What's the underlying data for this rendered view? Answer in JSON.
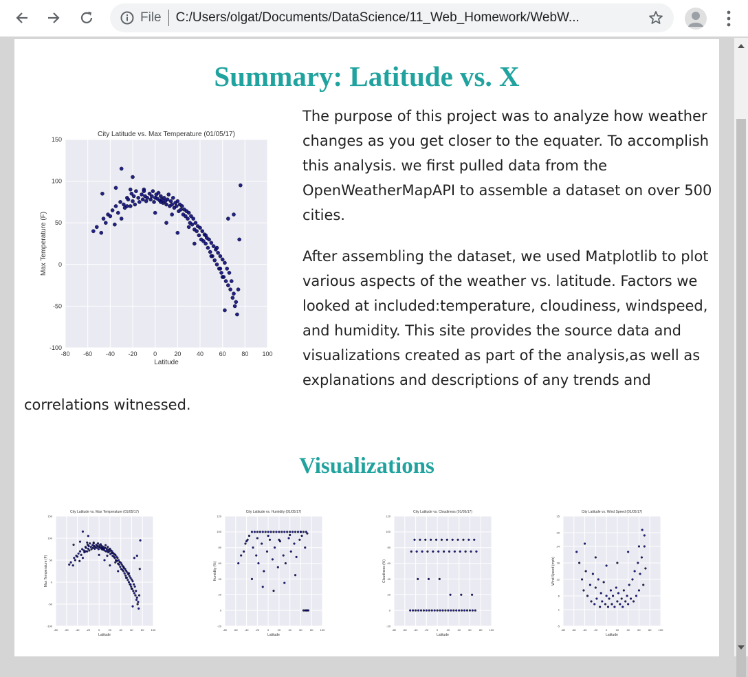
{
  "browser": {
    "scheme": "File",
    "url": "C:/Users/olgat/Documents/DataScience/11_Web_Homework/WebW..."
  },
  "page": {
    "title": "Summary: Latitude vs. X",
    "paragraph1": "The purpose of this project was to analyze how weather changes as you get closer to the equater. To accomplish this analysis. we first pulled data from the OpenWeatherMapAPI to assemble a dataset on over 500 cities.",
    "paragraph2": "After assembling the dataset, we used Matplotlib to plot various aspects of the weather vs. latitude. Factors we looked at included:temperature, cloudiness, windspeed, and humidity. This site provides the source data and visualizations created as part of the analysis,as well as explanations and descriptions of any trends and correlations witnessed.",
    "visualizations_title": "Visualizations"
  },
  "colors": {
    "accent": "#20a39e",
    "plot_bg": "#eaeaf2",
    "point": "#0b0b7a"
  },
  "chart_data": [
    {
      "type": "scatter",
      "title": "City Latitude vs. Max Temperature (01/05/17)",
      "xlabel": "Latitude",
      "ylabel": "Max Temperature (F)",
      "xlim": [
        -80,
        100
      ],
      "ylim": [
        -100,
        150
      ],
      "xticks": [
        -80,
        -60,
        -40,
        -20,
        0,
        20,
        40,
        60,
        80,
        100
      ],
      "yticks": [
        -100,
        -50,
        0,
        50,
        100,
        150
      ],
      "grid": true,
      "x": [
        -55,
        -52,
        -48,
        -46,
        -44,
        -42,
        -40,
        -38,
        -36,
        -35,
        -33,
        -31,
        -30,
        -28,
        -27,
        -25,
        -24,
        -22,
        -21,
        -20,
        -19,
        -18,
        -17,
        -15,
        -14,
        -12,
        -11,
        -10,
        -9,
        -8,
        -7,
        -5,
        -4,
        -3,
        -2,
        -1,
        0,
        1,
        2,
        3,
        4,
        5,
        6,
        7,
        8,
        9,
        10,
        11,
        12,
        13,
        14,
        15,
        16,
        17,
        18,
        19,
        20,
        21,
        22,
        23,
        24,
        25,
        26,
        27,
        28,
        29,
        30,
        31,
        32,
        33,
        34,
        35,
        36,
        37,
        38,
        39,
        40,
        41,
        42,
        43,
        44,
        45,
        46,
        47,
        48,
        49,
        50,
        51,
        52,
        53,
        54,
        55,
        56,
        57,
        58,
        59,
        60,
        61,
        62,
        63,
        64,
        65,
        66,
        67,
        68,
        69,
        70,
        71,
        72,
        73,
        74,
        75,
        76,
        -30,
        -20,
        -22,
        -10,
        5,
        15,
        30,
        45,
        55,
        60,
        65,
        70,
        -47,
        -35,
        -25,
        0,
        10,
        20,
        35,
        50,
        58,
        62,
        68,
        72
      ],
      "y": [
        40,
        45,
        38,
        55,
        50,
        60,
        58,
        65,
        48,
        70,
        62,
        75,
        55,
        72,
        68,
        80,
        78,
        70,
        85,
        76,
        82,
        72,
        88,
        80,
        75,
        84,
        78,
        90,
        82,
        76,
        80,
        85,
        78,
        82,
        88,
        75,
        80,
        84,
        79,
        86,
        77,
        82,
        78,
        74,
        80,
        76,
        72,
        78,
        84,
        70,
        76,
        72,
        80,
        68,
        74,
        70,
        76,
        64,
        72,
        66,
        70,
        60,
        66,
        58,
        64,
        55,
        62,
        50,
        58,
        48,
        55,
        42,
        50,
        40,
        46,
        35,
        44,
        30,
        40,
        28,
        36,
        25,
        32,
        20,
        30,
        15,
        26,
        10,
        22,
        5,
        18,
        0,
        14,
        -5,
        10,
        -10,
        6,
        -15,
        2,
        -20,
        -5,
        -25,
        -10,
        -30,
        -20,
        -40,
        -35,
        -50,
        -45,
        -60,
        -30,
        30,
        95,
        115,
        105,
        90,
        88,
        75,
        60,
        45,
        35,
        20,
        -15,
        55,
        60,
        85,
        92,
        70,
        62,
        50,
        38,
        25,
        10,
        -5,
        -55
      ],
      "series_name": ""
    },
    {
      "type": "scatter",
      "title": "City Latitude vs. Humidity (01/05/17)",
      "xlabel": "Latitude",
      "ylabel": "Humidity (%)",
      "xlim": [
        -80,
        100
      ],
      "ylim": [
        -20,
        120
      ],
      "x": [
        -55,
        -50,
        -45,
        -42,
        -38,
        -35,
        -30,
        -28,
        -25,
        -22,
        -20,
        -18,
        -15,
        -12,
        -10,
        -8,
        -5,
        -2,
        0,
        3,
        5,
        8,
        10,
        12,
        15,
        18,
        20,
        22,
        25,
        28,
        30,
        32,
        35,
        38,
        40,
        42,
        45,
        48,
        50,
        52,
        55,
        58,
        60,
        62,
        65,
        68,
        70,
        72,
        -30,
        -10,
        10,
        30,
        50,
        65,
        68,
        70,
        72,
        74,
        -40,
        -20,
        0,
        20,
        40,
        60
      ],
      "y": [
        60,
        70,
        75,
        85,
        90,
        95,
        100,
        80,
        100,
        70,
        100,
        60,
        100,
        85,
        100,
        50,
        100,
        75,
        100,
        90,
        100,
        65,
        100,
        80,
        100,
        55,
        100,
        88,
        100,
        70,
        100,
        60,
        100,
        92,
        100,
        75,
        100,
        85,
        100,
        68,
        100,
        90,
        100,
        95,
        100,
        80,
        100,
        98,
        40,
        30,
        25,
        35,
        45,
        0,
        0,
        0,
        0,
        0,
        88,
        92,
        95,
        90,
        96,
        100
      ],
      "series_name": ""
    },
    {
      "type": "scatter",
      "title": "City Latitude vs. Cloudiness (01/05/17)",
      "xlabel": "Latitude",
      "ylabel": "Cloudiness (%)",
      "xlim": [
        -80,
        100
      ],
      "ylim": [
        -20,
        120
      ],
      "x": [
        -50,
        -45,
        -40,
        -35,
        -30,
        -25,
        -20,
        -15,
        -10,
        -5,
        0,
        5,
        10,
        15,
        20,
        25,
        30,
        35,
        40,
        45,
        50,
        55,
        60,
        65,
        70,
        -48,
        -38,
        -28,
        -18,
        -8,
        2,
        12,
        22,
        32,
        42,
        52,
        62,
        72,
        -42,
        -32,
        -22,
        -12,
        -2,
        8,
        18,
        28,
        38,
        48,
        58,
        68,
        -36,
        -16,
        4,
        24,
        44,
        64
      ],
      "y": [
        0,
        0,
        0,
        0,
        0,
        0,
        0,
        0,
        0,
        0,
        0,
        0,
        0,
        0,
        0,
        0,
        0,
        0,
        0,
        0,
        0,
        0,
        0,
        0,
        0,
        75,
        75,
        75,
        75,
        75,
        75,
        75,
        75,
        75,
        75,
        75,
        75,
        75,
        90,
        90,
        90,
        90,
        90,
        90,
        90,
        90,
        90,
        90,
        90,
        90,
        40,
        40,
        40,
        20,
        20,
        20
      ],
      "series_name": ""
    },
    {
      "type": "scatter",
      "title": "City Latitude vs. Wind Speed (01/05/17)",
      "xlabel": "Latitude",
      "ylabel": "Wind Speed (mph)",
      "xlim": [
        -80,
        100
      ],
      "ylim": [
        -5,
        35
      ],
      "x": [
        -55,
        -50,
        -45,
        -42,
        -38,
        -35,
        -30,
        -28,
        -25,
        -22,
        -20,
        -18,
        -15,
        -12,
        -10,
        -8,
        -5,
        -2,
        0,
        3,
        5,
        8,
        10,
        12,
        15,
        18,
        20,
        22,
        25,
        28,
        30,
        32,
        35,
        38,
        40,
        42,
        45,
        48,
        50,
        52,
        55,
        58,
        60,
        62,
        65,
        68,
        70,
        72,
        -40,
        -20,
        0,
        20,
        40,
        60,
        66,
        70
      ],
      "y": [
        22,
        18,
        12,
        8,
        15,
        6,
        10,
        4,
        14,
        3,
        9,
        5,
        12,
        2,
        7,
        4,
        11,
        3,
        6,
        2,
        5,
        8,
        3,
        6,
        2,
        9,
        4,
        7,
        3,
        5,
        2,
        8,
        4,
        6,
        3,
        10,
        5,
        12,
        4,
        15,
        6,
        18,
        8,
        14,
        20,
        10,
        24,
        16,
        25,
        20,
        17,
        18,
        22,
        24,
        30,
        28
      ],
      "series_name": ""
    }
  ]
}
